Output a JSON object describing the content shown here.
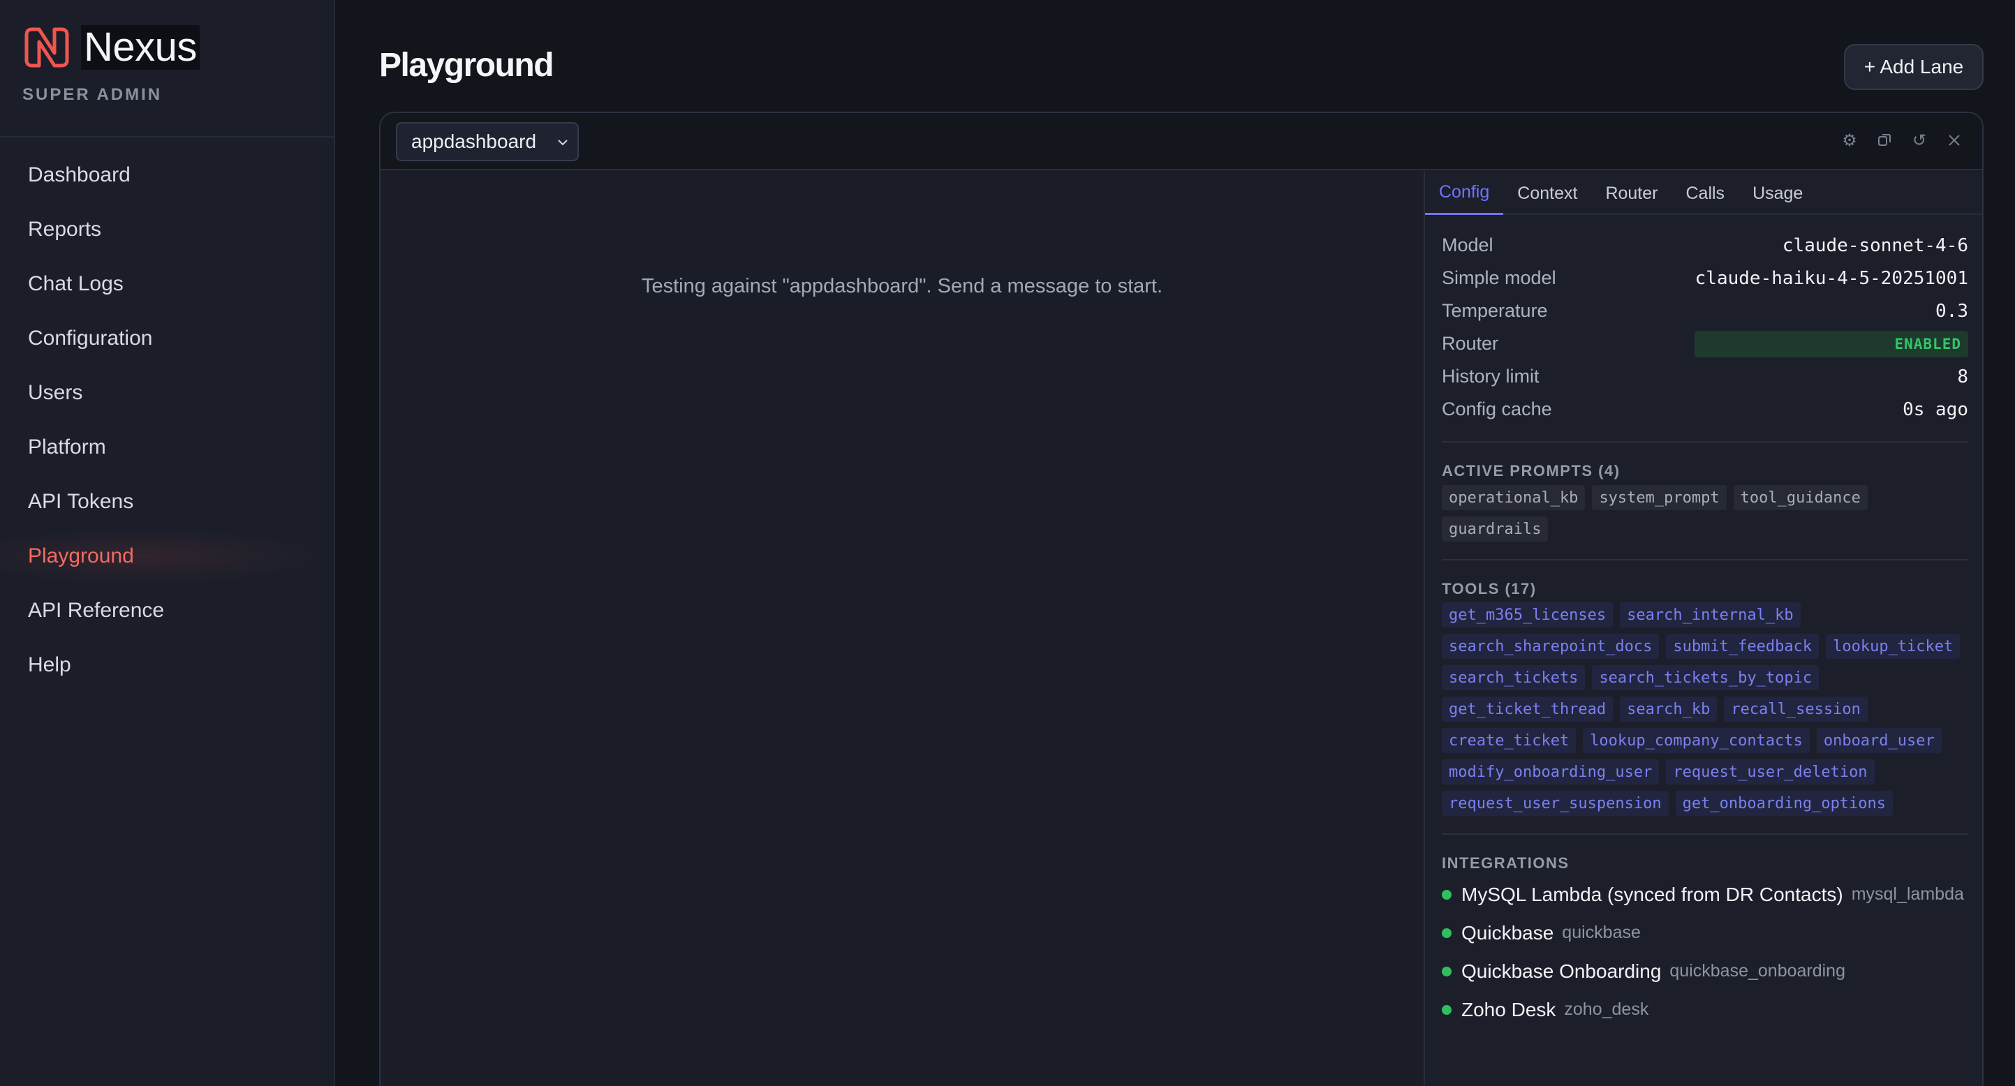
{
  "brand": {
    "name": "Nexus",
    "subtitle": "SUPER ADMIN",
    "accent": "#f0564f"
  },
  "sidebar": {
    "items": [
      {
        "label": "Dashboard"
      },
      {
        "label": "Reports"
      },
      {
        "label": "Chat Logs"
      },
      {
        "label": "Configuration"
      },
      {
        "label": "Users"
      },
      {
        "label": "Platform"
      },
      {
        "label": "API Tokens"
      },
      {
        "label": "Playground",
        "active": true
      },
      {
        "label": "API Reference"
      },
      {
        "label": "Help"
      }
    ]
  },
  "header": {
    "title": "Playground",
    "add_lane_label": "+ Add Lane"
  },
  "lane": {
    "selected_app": "appdashboard",
    "icons": [
      "gear-icon",
      "copy-icon",
      "refresh-icon",
      "close-icon"
    ],
    "empty_message": "Testing against \"appdashboard\". Send a message to start."
  },
  "inspector": {
    "tabs": [
      {
        "label": "Config",
        "active": true
      },
      {
        "label": "Context"
      },
      {
        "label": "Router"
      },
      {
        "label": "Calls"
      },
      {
        "label": "Usage"
      }
    ],
    "config": {
      "model_label": "Model",
      "model_value": "claude-sonnet-4-6",
      "simple_model_label": "Simple model",
      "simple_model_value": "claude-haiku-4-5-20251001",
      "temperature_label": "Temperature",
      "temperature_value": "0.3",
      "router_label": "Router",
      "router_value": "ENABLED",
      "history_label": "History limit",
      "history_value": "8",
      "cache_label": "Config cache",
      "cache_value": "0s ago"
    },
    "prompts_title": "ACTIVE PROMPTS (4)",
    "prompts": [
      "operational_kb",
      "system_prompt",
      "tool_guidance",
      "guardrails"
    ],
    "tools_title": "TOOLS (17)",
    "tools": [
      "get_m365_licenses",
      "search_internal_kb",
      "search_sharepoint_docs",
      "submit_feedback",
      "lookup_ticket",
      "search_tickets",
      "search_tickets_by_topic",
      "get_ticket_thread",
      "search_kb",
      "recall_session",
      "create_ticket",
      "lookup_company_contacts",
      "onboard_user",
      "modify_onboarding_user",
      "request_user_deletion",
      "request_user_suspension",
      "get_onboarding_options"
    ],
    "integrations_title": "INTEGRATIONS",
    "integrations": [
      {
        "name": "MySQL Lambda (synced from DR Contacts)",
        "id": "mysql_lambda"
      },
      {
        "name": "Quickbase",
        "id": "quickbase"
      },
      {
        "name": "Quickbase Onboarding",
        "id": "quickbase_onboarding"
      },
      {
        "name": "Zoho Desk",
        "id": "zoho_desk"
      }
    ]
  }
}
